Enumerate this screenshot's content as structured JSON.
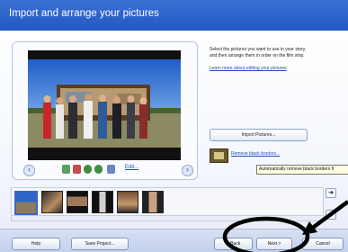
{
  "window": {
    "title": "Import and arrange your pictures"
  },
  "instructions": {
    "line1": "Select the pictures you want to use in your story,",
    "line2": "and then arrange them in order on the film strip.",
    "learn_link": "Learn more about editing your pictures"
  },
  "buttons": {
    "import": "Import Pictures...",
    "remove_black_borders": "Remove black borders...",
    "help": "Help",
    "save_project": "Save Project...",
    "back": "< Back",
    "next": "Next >",
    "cancel": "Cancel"
  },
  "tooltip": {
    "text": "Automatically remove black borders fr"
  },
  "preview_toolbar": {
    "edit_label": "Edit..."
  },
  "filmstrip": {
    "thumbnail_count": 6,
    "selected_index": 0
  },
  "icons": {
    "prev": "chevron-left-icon",
    "next": "chevron-right-icon",
    "move_right": "arrow-right-icon",
    "move_left": "arrow-left-icon",
    "borders": "picture-frame-icon"
  },
  "colors": {
    "header_blue": "#2a62c9",
    "link_blue": "#1f4fb7",
    "tooltip_bg": "#ffffe1"
  }
}
